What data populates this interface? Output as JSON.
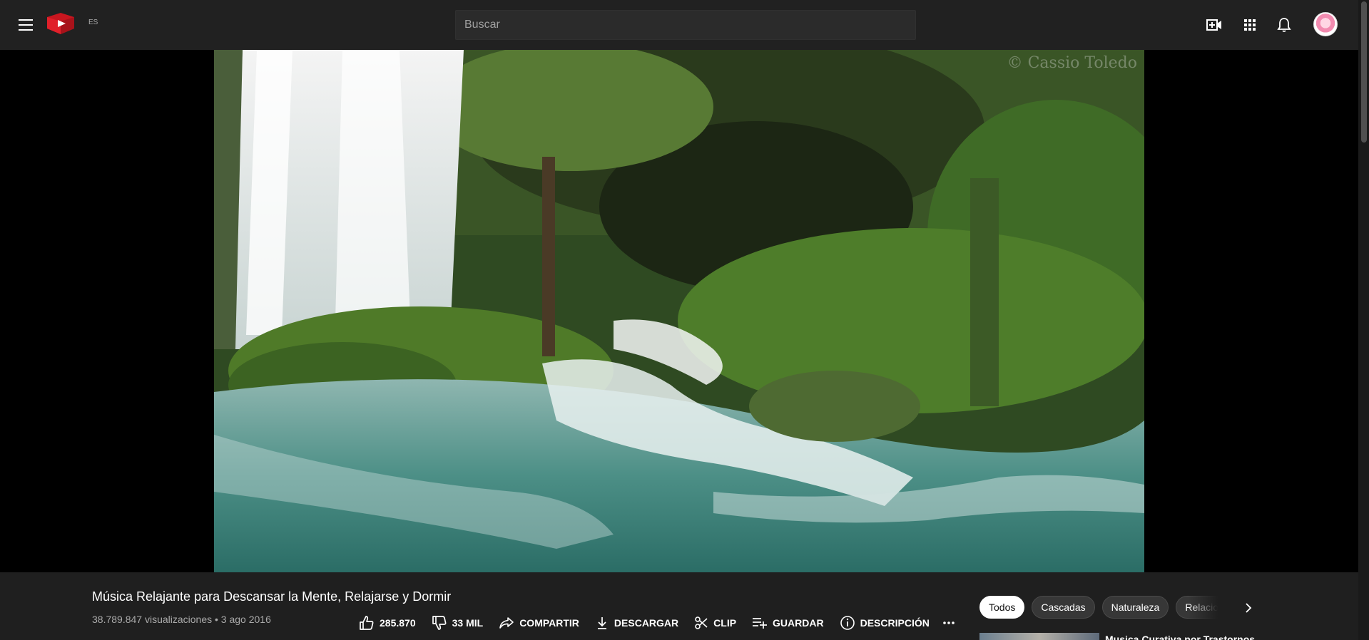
{
  "header": {
    "lang_label": "ES",
    "search_placeholder": "Buscar",
    "icons": [
      "menu-icon",
      "logo-icon",
      "create-video-icon",
      "apps-grid-icon",
      "bell-icon",
      "avatar"
    ]
  },
  "video": {
    "watermark": "© Cassio Toledo"
  },
  "info": {
    "title": "Música Relajante para Descansar la Mente, Relajarse y Dormir",
    "meta": "38.789.847 visualizaciones • 3 ago 2016",
    "actions": {
      "like": "285.870",
      "dislike": "33 MIL",
      "share": "COMPARTIR",
      "download": "DESCARGAR",
      "clip": "CLIP",
      "save": "GUARDAR",
      "description": "DESCRIPCIÓN"
    }
  },
  "chips": [
    "Todos",
    "Cascadas",
    "Naturaleza",
    "Relacionados"
  ],
  "recommendation": {
    "title": "Musica Curativa por Trastornos"
  },
  "colors": {
    "header_bg": "#212121",
    "info_bg": "#1f1f1f",
    "logo_red": "#e0202a",
    "chip_bg": "#373737",
    "chip_active_bg": "#ffffff"
  }
}
